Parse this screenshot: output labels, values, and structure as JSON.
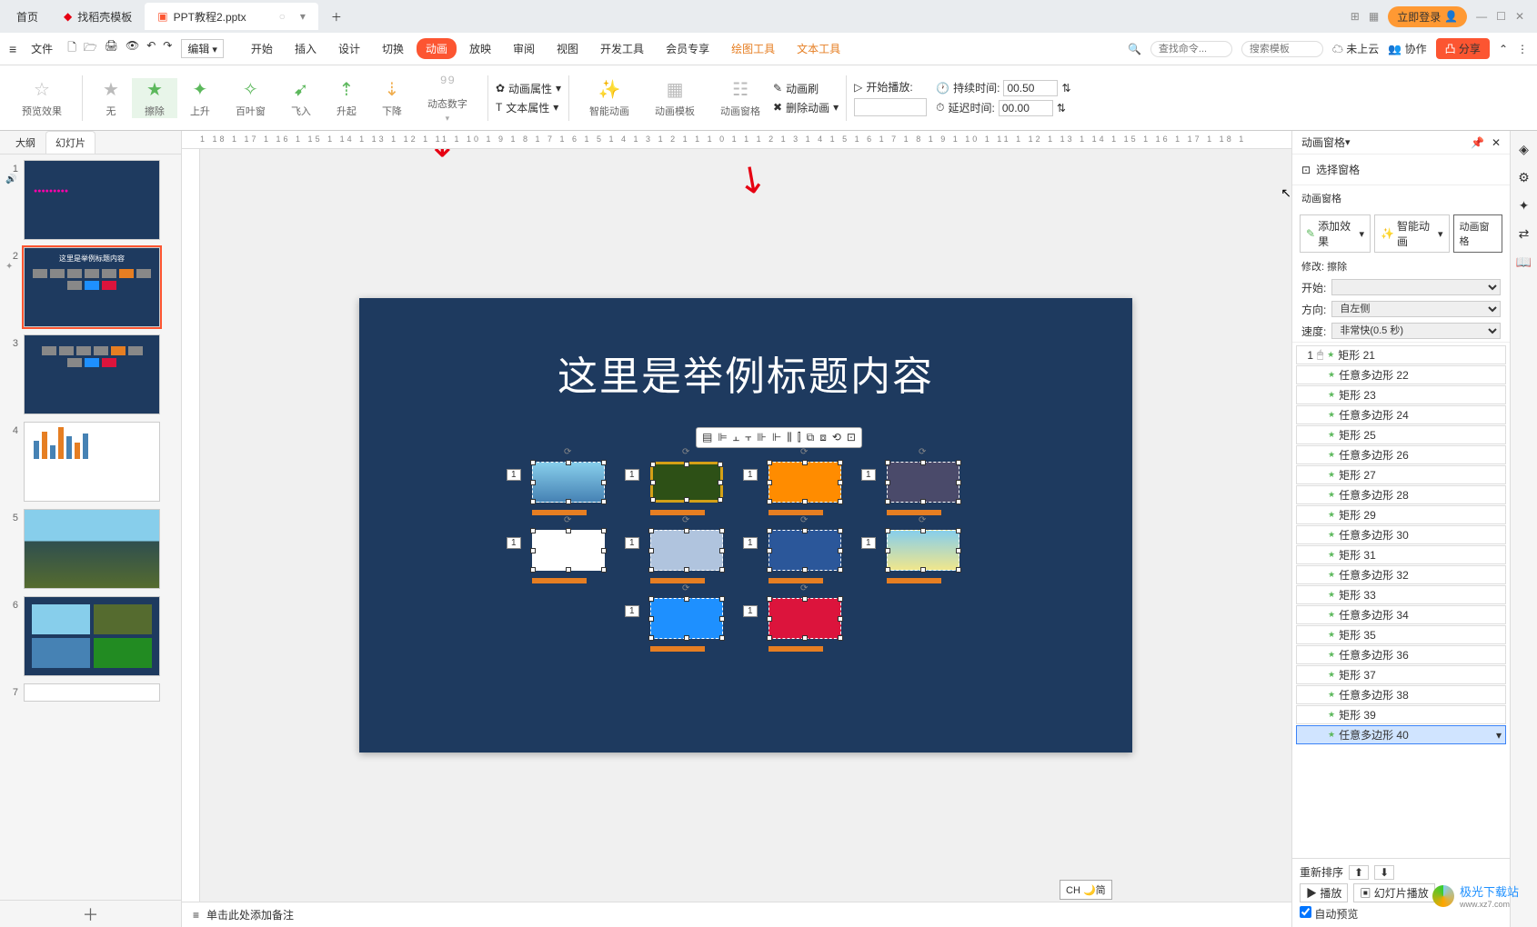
{
  "tabs": {
    "home": "首页",
    "t1": "找稻壳模板",
    "t2": "PPT教程2.pptx"
  },
  "topright": {
    "login": "立即登录"
  },
  "menubar": {
    "file": "文件",
    "edit": "编辑",
    "tabs": [
      "开始",
      "插入",
      "设计",
      "切换",
      "动画",
      "放映",
      "审阅",
      "视图",
      "开发工具",
      "会员专享",
      "绘图工具",
      "文本工具"
    ],
    "search_ph": "查找命令...",
    "tpl_ph": "搜索模板",
    "cloud": "未上云",
    "collab": "协作",
    "share": "分享"
  },
  "ribbon": {
    "preview": "预览效果",
    "none": "无",
    "wipe": "擦除",
    "rise": "上升",
    "clover": "百叶窗",
    "flyin": "飞入",
    "ascend": "升起",
    "descend": "下降",
    "dynnum": "动态数字",
    "animprop": "动画属性",
    "textprop": "文本属性",
    "smart": "智能动画",
    "animtpl": "动画模板",
    "animpane": "动画窗格",
    "animbrush": "动画刷",
    "delanim": "删除动画",
    "starttime": "开始播放:",
    "duration": "持续时间:",
    "delay": "延迟时间:",
    "duration_val": "00.50",
    "delay_val": "00.00"
  },
  "leftpanel": {
    "outline": "大纲",
    "slides": "幻灯片"
  },
  "slide": {
    "title": "这里是举例标题内容",
    "thumb2_title": "这里是举例标题内容",
    "objnum": "1"
  },
  "notes": {
    "placeholder": "单击此处添加备注"
  },
  "rightpanel": {
    "head": "动画窗格",
    "selpane": "选择窗格",
    "title": "动画窗格",
    "addfx": "添加效果",
    "smart": "智能动画",
    "animpane_btn": "动画窗格",
    "modify": "修改: 擦除",
    "start": "开始:",
    "direction": "方向:",
    "direction_val": "自左侧",
    "speed": "速度:",
    "speed_val": "非常快(0.5 秒)",
    "items": [
      "矩形 21",
      "任意多边形 22",
      "矩形 23",
      "任意多边形 24",
      "矩形 25",
      "任意多边形 26",
      "矩形 27",
      "任意多边形 28",
      "矩形 29",
      "任意多边形 30",
      "矩形 31",
      "任意多边形 32",
      "矩形 33",
      "任意多边形 34",
      "矩形 35",
      "任意多边形 36",
      "矩形 37",
      "任意多边形 38",
      "矩形 39",
      "任意多边形 40"
    ],
    "first_index": "1",
    "reorder": "重新排序",
    "play": "播放",
    "slideplay": "幻灯片播放",
    "autoprev": "自动预览"
  },
  "ime": "CH 🌙简",
  "watermark": "极光下载站",
  "watermark_url": "www.xz7.com",
  "ruler": "1 18 1 17 1 16 1 15 1 14 1 13 1 12 1 11 1 10 1 9 1 8 1 7 1 6 1 5 1 4 1 3 1 2 1 1 1 0 1 1 1 2 1 3 1 4 1 5 1 6 1 7 1 8 1 9 1 10 1 11 1 12 1 13 1 14 1 15 1 16 1 17 1 18 1"
}
